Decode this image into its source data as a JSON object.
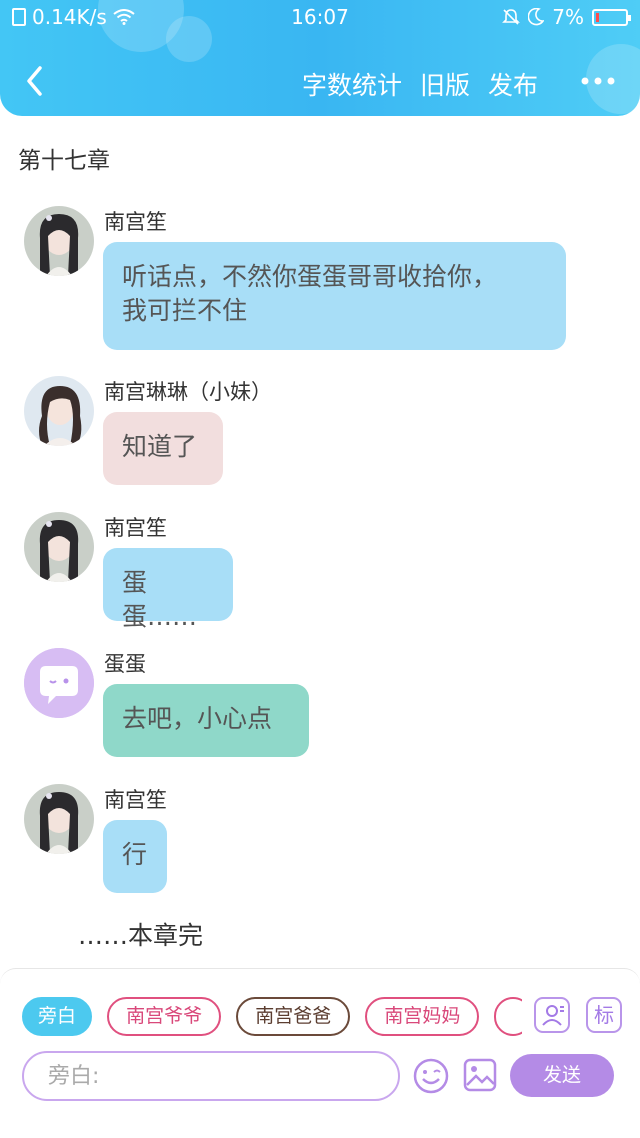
{
  "status_bar": {
    "network_speed": "0.14K/s",
    "time": "16:07",
    "battery": "7%"
  },
  "header": {
    "actions": [
      "字数统计",
      "旧版",
      "发布"
    ],
    "icons": [
      "back-icon",
      "more-icon"
    ]
  },
  "chapter": {
    "title": "第十七章",
    "end_text": "……本章完"
  },
  "messages": [
    {
      "speaker": "南宫笙",
      "text_lines": [
        "听话点，不然你蛋蛋哥哥收拾你，",
        "我可拦不住"
      ],
      "bubble_color": "#a8def7",
      "avatar": "girl-avatar"
    },
    {
      "speaker": "南宫琳琳（小妹）",
      "text_lines": [
        "知道了"
      ],
      "bubble_color": "#f2dede",
      "avatar": "girl-avatar-2"
    },
    {
      "speaker": "南宫笙",
      "text_lines": [
        "蛋蛋……"
      ],
      "bubble_color": "#a8def7",
      "avatar": "girl-avatar"
    },
    {
      "speaker": "蛋蛋",
      "text_lines": [
        "去吧，小心点"
      ],
      "bubble_color": "#8fd8c9",
      "avatar": "chat-bubble-avatar"
    },
    {
      "speaker": "南宫笙",
      "text_lines": [
        "行"
      ],
      "bubble_color": "#a8def7",
      "avatar": "girl-avatar"
    }
  ],
  "bottom_panel": {
    "role_chips": [
      "旁白",
      "南宫爷爷",
      "南宫爸爸",
      "南宫妈妈"
    ],
    "tool_icons": [
      "add-role-icon",
      "tag-icon"
    ],
    "tag_label": "标",
    "input_placeholder": "旁白:",
    "send_label": "发送"
  },
  "colors": {
    "header": "#39b6f2",
    "accent_purple": "#b48be6",
    "active_chip": "#4cc9ef"
  }
}
